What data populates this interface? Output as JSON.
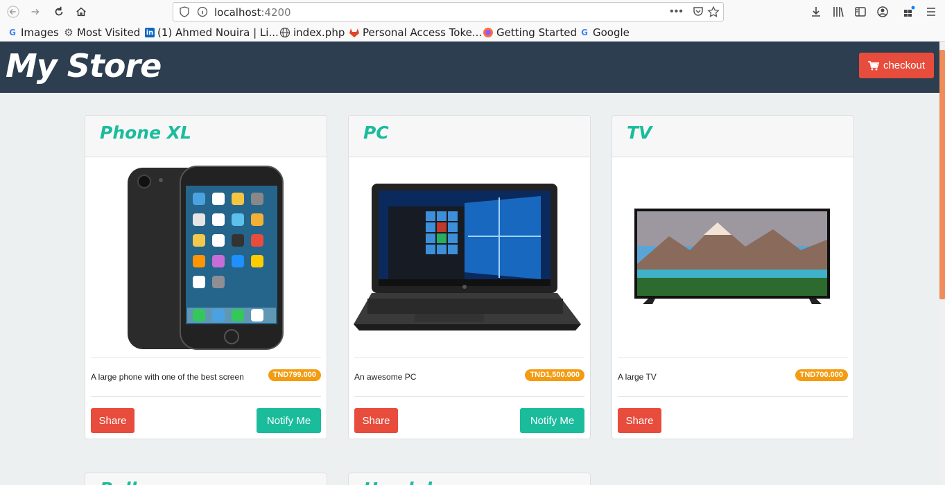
{
  "browser": {
    "url_host": "localhost",
    "url_port": ":4200"
  },
  "bookmarks": [
    {
      "label": "Images",
      "icon": "google-icon"
    },
    {
      "label": "Most Visited",
      "icon": "gear-icon"
    },
    {
      "label": "(1) Ahmed Nouira | Li...",
      "icon": "linkedin-icon"
    },
    {
      "label": "index.php",
      "icon": "globe-icon"
    },
    {
      "label": "Personal Access Toke...",
      "icon": "gitlab-icon"
    },
    {
      "label": "Getting Started",
      "icon": "firefox-icon"
    },
    {
      "label": "Google",
      "icon": "google-icon"
    }
  ],
  "header": {
    "brand": "My Store",
    "checkout_label": "checkout"
  },
  "products": [
    {
      "name": "Phone XL",
      "description": "A large phone with one of the best screen",
      "price": "TND799.000",
      "share_label": "Share",
      "notify_label": "Notify Me"
    },
    {
      "name": "PC",
      "description": "An awesome PC",
      "price": "TND1,500.000",
      "share_label": "Share",
      "notify_label": "Notify Me"
    },
    {
      "name": "TV",
      "description": "A large TV",
      "price": "TND700.000",
      "share_label": "Share"
    }
  ],
  "partial_products": [
    {
      "name": "Bell"
    },
    {
      "name": "Headph"
    }
  ],
  "colors": {
    "header_bg": "#2c3e50",
    "accent": "#1abc9c",
    "danger": "#e74c3c",
    "badge": "#f39c12"
  }
}
